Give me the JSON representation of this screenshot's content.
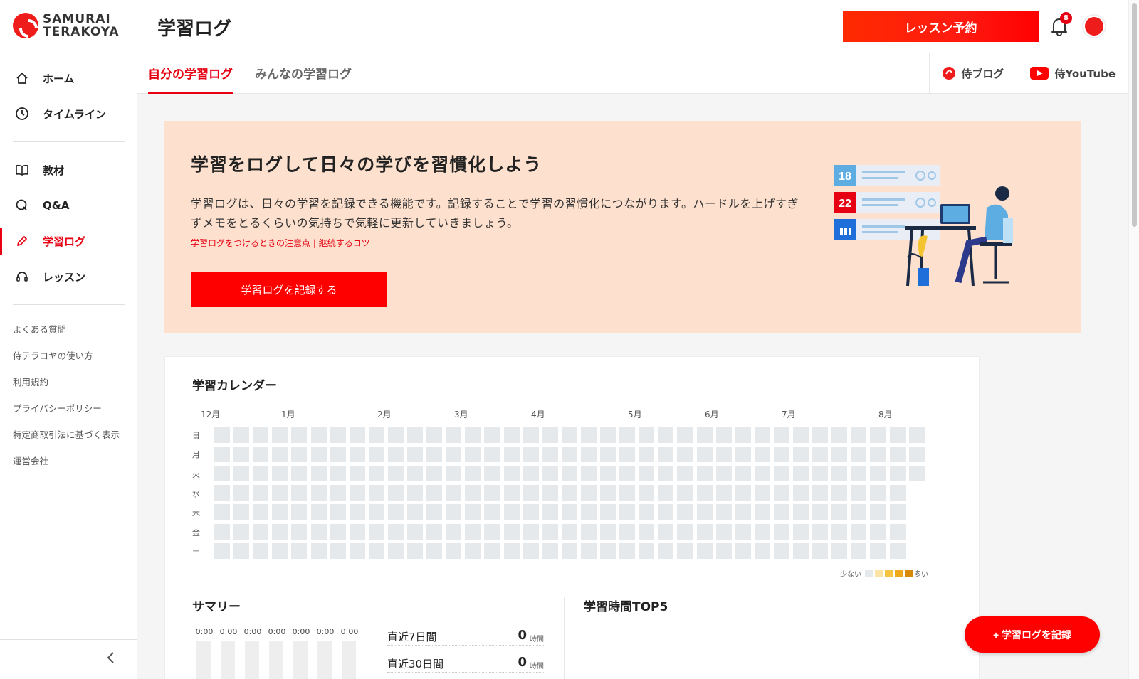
{
  "brand": {
    "line1": "SAMURAI",
    "line2": "TERAKOYA"
  },
  "nav": {
    "main": [
      {
        "label": "ホーム",
        "icon": "home-icon"
      },
      {
        "label": "タイムライン",
        "icon": "clock-icon"
      }
    ],
    "learn": [
      {
        "label": "教材",
        "icon": "book-icon"
      },
      {
        "label": "Q&A",
        "icon": "qa-icon"
      },
      {
        "label": "学習ログ",
        "icon": "pencil-icon",
        "active": true
      },
      {
        "label": "レッスン",
        "icon": "headset-icon"
      }
    ],
    "links": [
      "よくある質問",
      "侍テラコヤの使い方",
      "利用規約",
      "プライバシーポリシー",
      "特定商取引法に基づく表示",
      "運営会社"
    ],
    "collapse_icon": "chevron-left-icon"
  },
  "header": {
    "title": "学習ログ",
    "reserve_label": "レッスン予約",
    "notification_count": "8",
    "accent": "#e60012"
  },
  "tabs": {
    "items": [
      "自分の学習ログ",
      "みんなの学習ログ"
    ],
    "blog_label": "侍ブログ",
    "youtube_label": "侍YouTube"
  },
  "banner": {
    "title": "学習をログして日々の学びを習慣化しよう",
    "description": "学習ログは、日々の学習を記録できる機能です。記録することで学習の習慣化につながります。ハードルを上げすぎずメモをとるくらいの気持ちで気軽に更新していきましょう。",
    "link1": "学習ログをつけるときの注意点",
    "link_sep": " | ",
    "link2": "継続するコツ",
    "button_label": "学習ログを記録する",
    "illustration": {
      "dates": [
        "18",
        "22"
      ]
    },
    "background": "#fde0cd"
  },
  "calendar": {
    "title": "学習カレンダー",
    "months": [
      "12月",
      "1月",
      "2月",
      "3月",
      "4月",
      "5月",
      "6月",
      "7月",
      "8月"
    ],
    "weekdays": [
      "日",
      "月",
      "火",
      "水",
      "木",
      "金",
      "土"
    ],
    "legend_less": "少ない",
    "legend_more": "多い",
    "legend_colors": [
      "#e6e9ec",
      "#fbe3a6",
      "#f6c443",
      "#eda919",
      "#d88a06"
    ],
    "empty_color": "#e6e9ec"
  },
  "summary": {
    "title": "サマリー",
    "daily_times": [
      "0:00",
      "0:00",
      "0:00",
      "0:00",
      "0:00",
      "0:00",
      "0:00"
    ],
    "stats": [
      {
        "label": "直近7日間",
        "value": "0",
        "unit": "時間"
      },
      {
        "label": "直近30日間",
        "value": "0",
        "unit": "時間"
      }
    ]
  },
  "top5": {
    "title": "学習時間TOP5"
  },
  "fab_label": "+ 学習ログを記録"
}
